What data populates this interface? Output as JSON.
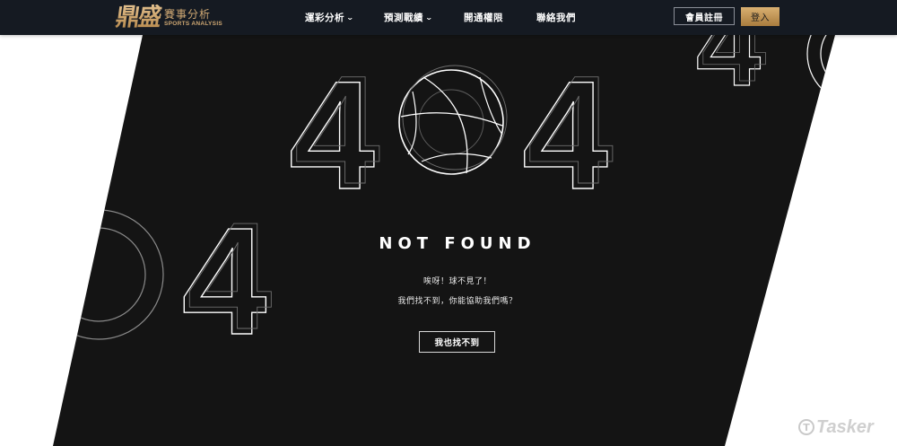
{
  "logo": {
    "mark": "鼎盛",
    "cn": "賽事分析",
    "en": "SPORTS ANALYSIS"
  },
  "nav": {
    "items": [
      {
        "label": "運彩分析",
        "has_dropdown": true
      },
      {
        "label": "預測戰績",
        "has_dropdown": true
      },
      {
        "label": "開通權限",
        "has_dropdown": false
      },
      {
        "label": "聯絡我們",
        "has_dropdown": false
      }
    ],
    "caret": "⌄",
    "register_label": "會員註冊",
    "login_label": "登入"
  },
  "error": {
    "code": "404",
    "heading": "NOT FOUND",
    "line1": "唉呀！球不見了！",
    "line2": "我們找不到，你能協助我們嗎？",
    "button_label": "我也找不到"
  },
  "watermark": {
    "glyph": "T",
    "text": "Tasker"
  },
  "colors": {
    "header_bg": "#151a22",
    "panel_bg": "#141414",
    "gold": "#c49b62",
    "outline": "#ffffff"
  }
}
